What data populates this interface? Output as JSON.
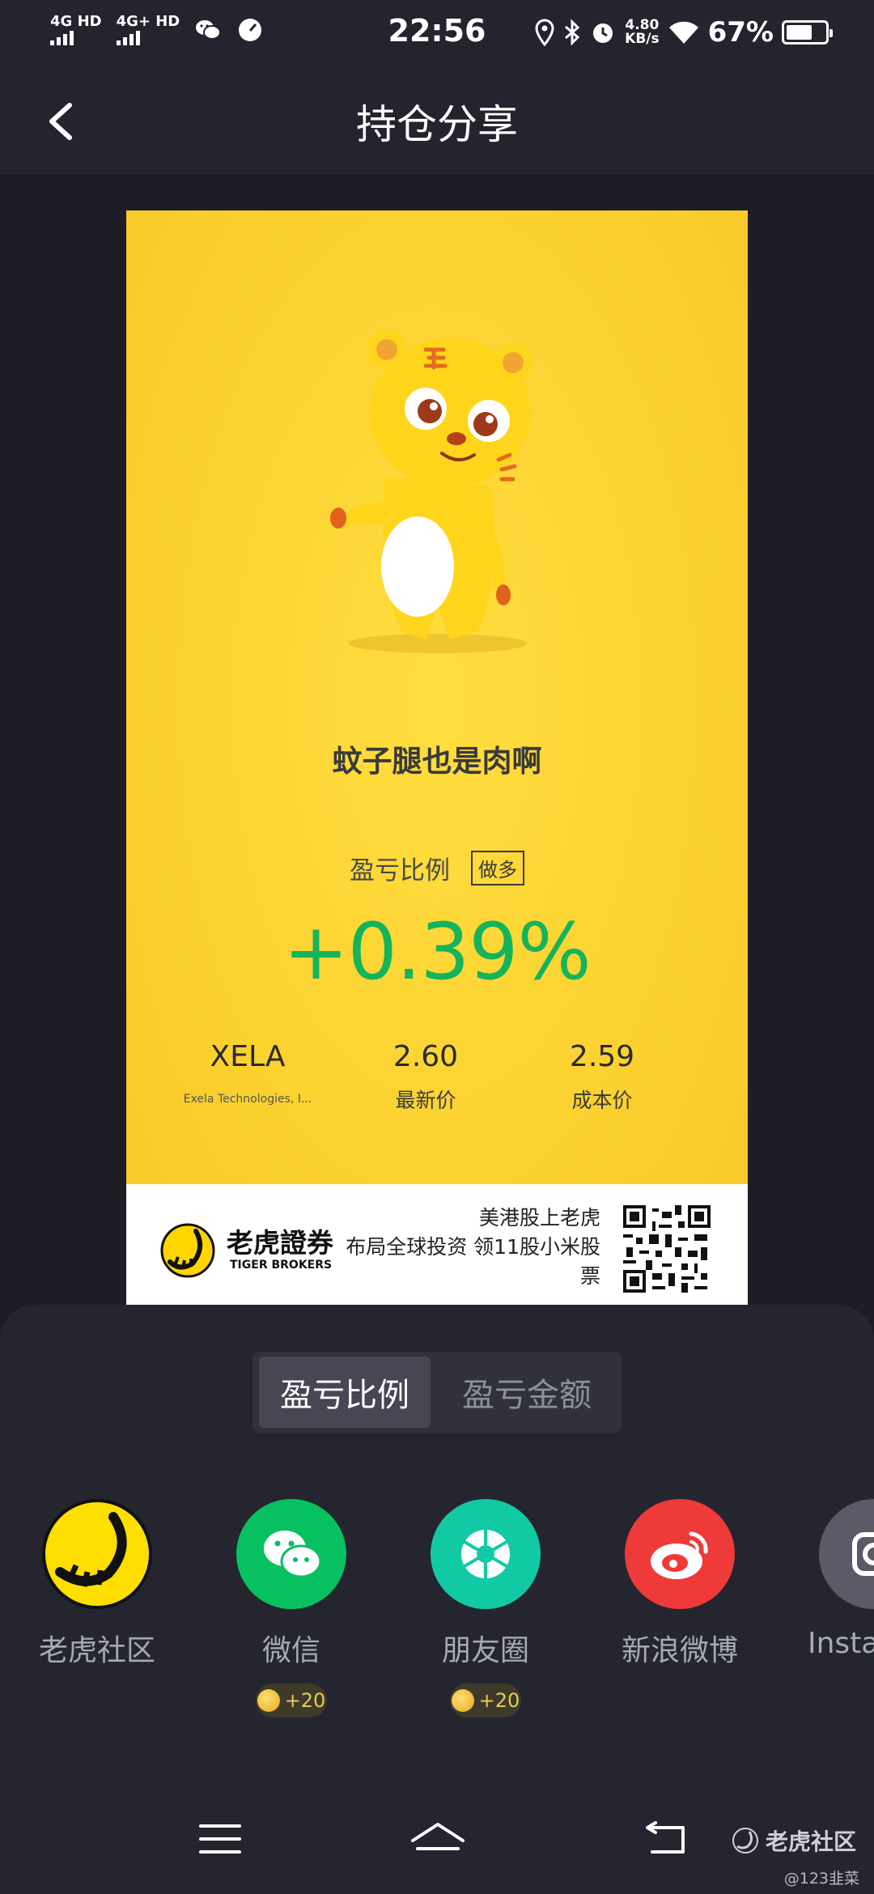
{
  "status_bar": {
    "signal1": "4G HD",
    "signal2": "4G+ HD",
    "time": "22:56",
    "speed_value": "4.80",
    "speed_unit": "KB/s",
    "battery_pct": "67%",
    "battery_level": 0.67
  },
  "header": {
    "title": "持仓分享",
    "back_icon": "chevron-left-icon"
  },
  "card": {
    "slogan": "蚊子腿也是肉啊",
    "pl_label": "盈亏比例",
    "pl_tag": "做多",
    "pl_value": "+0.39%",
    "stock": {
      "symbol": "XELA",
      "name": "Exela Technologies, I..."
    },
    "latest_price": {
      "value": "2.60",
      "label": "最新价"
    },
    "cost_price": {
      "value": "2.59",
      "label": "成本价"
    },
    "footer": {
      "brand_cn": "老虎證券",
      "brand_en": "TIGER BROKERS",
      "promo_line1": "美港股上老虎",
      "promo_line2": "布局全球投资 领11股小米股",
      "promo_line3": "票"
    }
  },
  "toggle": {
    "option1": "盈亏比例",
    "option2": "盈亏金额",
    "selected": "option1"
  },
  "share_targets": [
    {
      "label": "老虎社区",
      "icon": "tiger-community-icon",
      "color": "#ffdf00"
    },
    {
      "label": "微信",
      "icon": "wechat-icon",
      "color": "#07c160",
      "reward": "+20"
    },
    {
      "label": "朋友圈",
      "icon": "moments-icon",
      "color": "#12c9a6",
      "reward": "+20"
    },
    {
      "label": "新浪微博",
      "icon": "weibo-icon",
      "color": "#ee3b39"
    },
    {
      "label": "Insta",
      "icon": "instagram-icon",
      "color": "#5a5b66"
    }
  ],
  "watermark": {
    "brand": "老虎社区",
    "user": "@123韭菜"
  }
}
